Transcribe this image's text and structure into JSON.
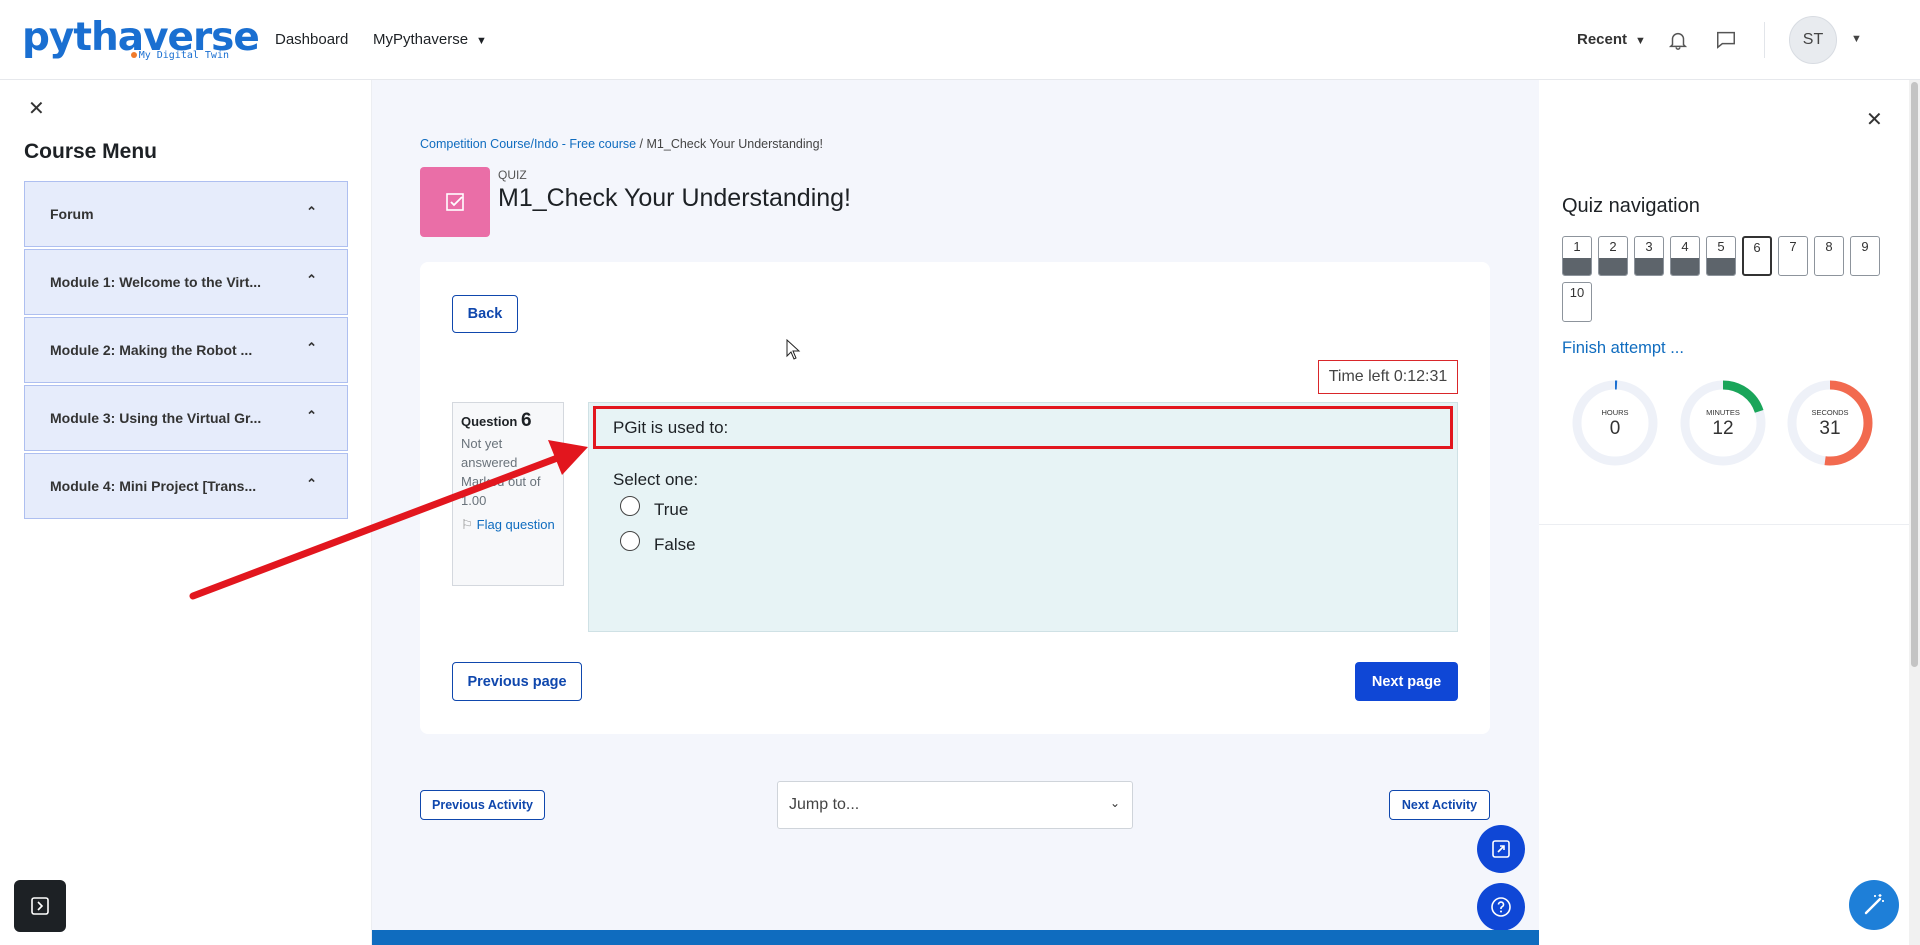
{
  "navbar": {
    "logo_text": "pythaverse",
    "logo_tagline": "My Digital Twin",
    "links": {
      "dashboard": "Dashboard",
      "mypythaverse": "MyPythaverse"
    },
    "recent": "Recent",
    "avatar_initials": "ST"
  },
  "course_menu": {
    "title": "Course Menu",
    "items": [
      {
        "label": "Forum"
      },
      {
        "label": "Module 1: Welcome to the Virt..."
      },
      {
        "label": "Module 2: Making the Robot ..."
      },
      {
        "label": "Module 3: Using the Virtual Gr..."
      },
      {
        "label": "Module 4: Mini Project [Trans..."
      }
    ]
  },
  "breadcrumb": {
    "course": "Competition Course/Indo - Free course",
    "separator": " / ",
    "current": "M1_Check Your Understanding!"
  },
  "activity": {
    "kicker": "QUIZ",
    "title": "M1_Check Your Understanding!",
    "icon": "checkbox-icon"
  },
  "quiz": {
    "back": "Back",
    "time_left": "Time left 0:12:31",
    "question_label": "Question",
    "question_number": "6",
    "status": "Not yet answered",
    "marks": "Marked out of 1.00",
    "flag": "Flag question",
    "question_text": "PGit is used to:",
    "prompt": "Select one:",
    "options": [
      {
        "label": "True"
      },
      {
        "label": "False"
      }
    ],
    "prev_page": "Previous page",
    "next_page": "Next page"
  },
  "activity_nav": {
    "prev": "Previous Activity",
    "jump_placeholder": "Jump to...",
    "next": "Next Activity"
  },
  "quiz_nav": {
    "title": "Quiz navigation",
    "buttons": [
      {
        "n": "1",
        "state": "answered"
      },
      {
        "n": "2",
        "state": "answered"
      },
      {
        "n": "3",
        "state": "answered"
      },
      {
        "n": "4",
        "state": "answered"
      },
      {
        "n": "5",
        "state": "answered"
      },
      {
        "n": "6",
        "state": "current"
      },
      {
        "n": "7",
        "state": "unanswered"
      },
      {
        "n": "8",
        "state": "unanswered"
      },
      {
        "n": "9",
        "state": "unanswered"
      },
      {
        "n": "10",
        "state": "unanswered"
      }
    ],
    "finish": "Finish attempt ...",
    "timer": {
      "hours": {
        "label": "HOURS",
        "value": "0",
        "fraction": 0.0
      },
      "minutes": {
        "label": "MINUTES",
        "value": "12",
        "fraction": 0.2
      },
      "seconds": {
        "label": "SECONDS",
        "value": "31",
        "fraction": 0.52
      }
    }
  },
  "colors": {
    "accent": "#0f47d6",
    "link": "#0f6cbf",
    "annotation": "#e2161e",
    "quiz_icon": "#ea6ea7",
    "minutes_ring": "#1aa55a",
    "seconds_ring": "#f26a4f",
    "hours_ring": "#1a6fd1"
  }
}
